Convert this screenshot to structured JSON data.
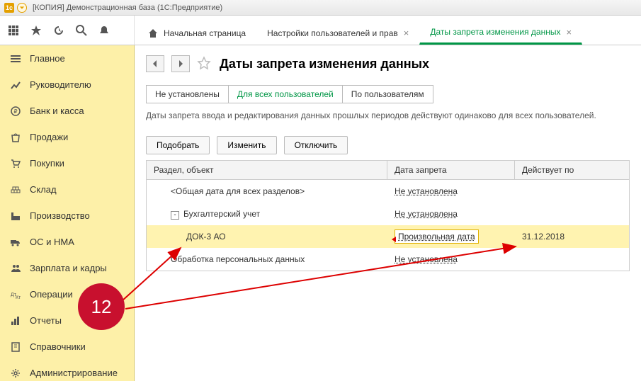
{
  "window": {
    "title": "[КОПИЯ] Демонстрационная база  (1С:Предприятие)"
  },
  "tabs": [
    {
      "label": "Начальная страница",
      "closable": false,
      "home": true
    },
    {
      "label": "Настройки пользователей и прав",
      "closable": true
    },
    {
      "label": "Даты запрета изменения данных",
      "closable": true,
      "active": true
    }
  ],
  "sidebar": {
    "items": [
      {
        "label": "Главное",
        "icon": "menu-icon"
      },
      {
        "label": "Руководителю",
        "icon": "chart-icon"
      },
      {
        "label": "Банк и касса",
        "icon": "ruble-icon"
      },
      {
        "label": "Продажи",
        "icon": "bag-icon"
      },
      {
        "label": "Покупки",
        "icon": "cart-icon"
      },
      {
        "label": "Склад",
        "icon": "warehouse-icon"
      },
      {
        "label": "Производство",
        "icon": "factory-icon"
      },
      {
        "label": "ОС и НМА",
        "icon": "truck-icon"
      },
      {
        "label": "Зарплата и кадры",
        "icon": "people-icon"
      },
      {
        "label": "Операции",
        "icon": "operations-icon"
      },
      {
        "label": "Отчеты",
        "icon": "report-icon"
      },
      {
        "label": "Справочники",
        "icon": "book-icon"
      },
      {
        "label": "Администрирование",
        "icon": "gear-icon"
      }
    ]
  },
  "page": {
    "title": "Даты запрета изменения данных",
    "filter_tabs": [
      "Не установлены",
      "Для всех пользователей",
      "По пользователям"
    ],
    "active_filter": 1,
    "info": "Даты запрета ввода и редактирования данных прошлых периодов действуют одинаково для всех пользователей.",
    "buttons": {
      "pick": "Подобрать",
      "edit": "Изменить",
      "off": "Отключить"
    },
    "grid": {
      "headers": {
        "section": "Раздел, объект",
        "date": "Дата запрета",
        "effective": "Действует по"
      },
      "rows": [
        {
          "section": "<Общая дата для всех разделов>",
          "date": "Не установлена",
          "effective": "",
          "indent": 1
        },
        {
          "section": "Бухгалтерский учет",
          "date": "Не установлена",
          "effective": "",
          "indent": 1,
          "toggle": "-"
        },
        {
          "section": "ДОК-3 АО",
          "date": "Произвольная дата",
          "effective": "31.12.2018",
          "indent": 2,
          "selected": true
        },
        {
          "section": "Обработка персональных данных",
          "date": "Не установлена",
          "effective": "",
          "indent": 1
        }
      ]
    }
  },
  "callout": {
    "number": "12"
  }
}
